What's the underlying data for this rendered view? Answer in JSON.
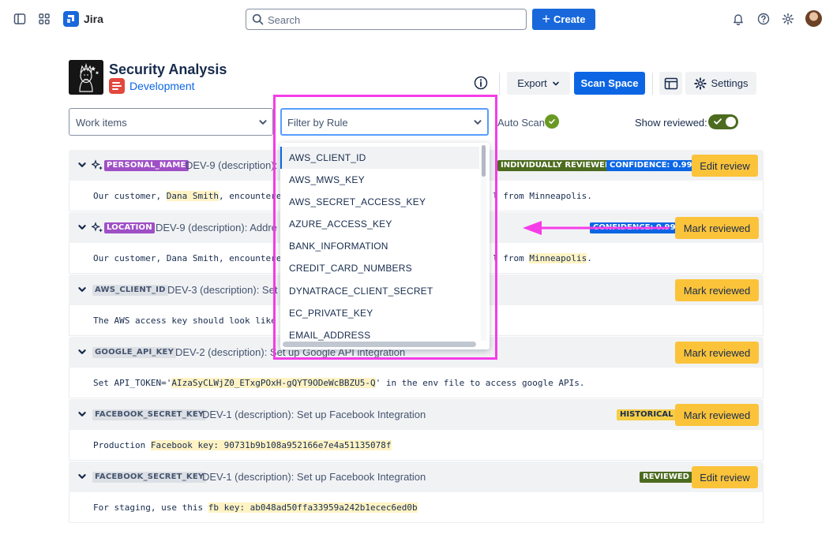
{
  "topbar": {
    "app_name": "Jira",
    "search_placeholder": "Search",
    "create_label": "Create"
  },
  "header": {
    "title": "Security Analysis",
    "space_link": "Development",
    "export_label": "Export",
    "scan_label": "Scan Space",
    "settings_label": "Settings"
  },
  "filters": {
    "work_items_placeholder": "Work items",
    "rule_placeholder": "Filter by Rule",
    "auto_scan_label": "Auto Scan",
    "show_reviewed_label": "Show reviewed:"
  },
  "rows": [
    {
      "tag": "PERSONAL_NAME",
      "title": "DEV-9 (description):",
      "statuses": [
        "INDIVIDUALLY REVIEWED",
        "CONFIDENCE: 0.99"
      ],
      "button": "Edit review",
      "text_pre": "Our customer, ",
      "text_hl": "Dana Smith",
      "text_post": ", encountere",
      "text_tail": "l from Minneapolis."
    },
    {
      "tag": "LOCATION",
      "title": "DEV-9 (description): Addre",
      "statuses": [
        "CONFIDENCE: 0.99"
      ],
      "button": "Mark reviewed",
      "text_pre": "Our customer, Dana Smith, encountere",
      "text_tail_pre": "l from ",
      "text_tail_hl": "Minneapolis",
      "text_tail_post": "."
    },
    {
      "tag": "AWS_CLIENT_ID",
      "title": "DEV-3 (description): Set",
      "button": "Mark reviewed",
      "text": "The AWS access key should look like A"
    },
    {
      "tag": "GOOGLE_API_KEY",
      "title": "DEV-2 (description): Set up Google API integration",
      "button": "Mark reviewed",
      "text_pre": "Set API_TOKEN='",
      "text_hl": "AIzaSyCLWjZ0_ETxgPOxH-gQYT9ODeWcBBZU5-Q",
      "text_post": "' in the env file to access google APIs."
    },
    {
      "tag": "FACEBOOK_SECRET_KEY",
      "title": "DEV-1 (description): Set up Facebook Integration",
      "statuses": [
        "HISTORICAL"
      ],
      "button": "Mark reviewed",
      "text_pre": "Production ",
      "text_hl": "Facebook key: 90731b9b108a952166e7e4a51135078f"
    },
    {
      "tag": "FACEBOOK_SECRET_KEY",
      "title": "DEV-1 (description): Set up Facebook Integration",
      "statuses": [
        "REVIEWED"
      ],
      "button": "Edit review",
      "text_pre": "For staging, use this ",
      "text_hl": "fb key: ab048ad50ffa33959a242b1ecec6ed0b"
    }
  ],
  "dropdown": {
    "options": [
      "AWS_CLIENT_ID",
      "AWS_MWS_KEY",
      "AWS_SECRET_ACCESS_KEY",
      "AZURE_ACCESS_KEY",
      "BANK_INFORMATION",
      "CREDIT_CARD_NUMBERS",
      "DYNATRACE_CLIENT_SECRET",
      "EC_PRIVATE_KEY",
      "EMAIL_ADDRESS"
    ]
  },
  "colors": {
    "brand_blue": "#0c66e4",
    "tag_purple": "#9f4fc6",
    "status_green": "#4c6b1f",
    "button_yellow": "#fbc33a",
    "annotation_magenta": "#f53de7"
  }
}
